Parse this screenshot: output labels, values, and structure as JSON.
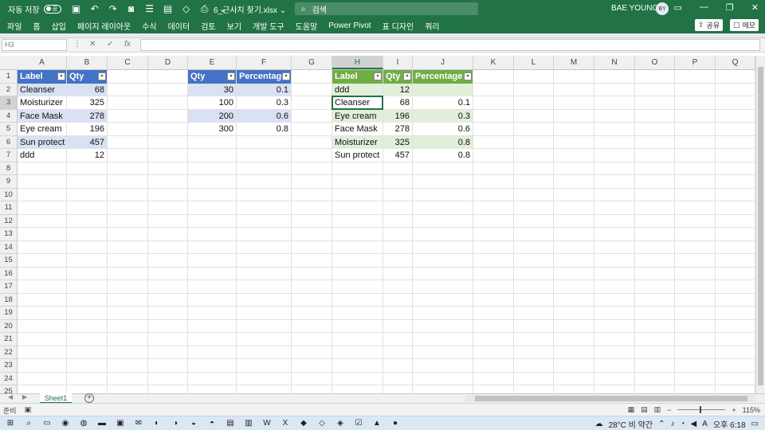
{
  "titlebar": {
    "autosave_label": "자동 저장",
    "autosave_state": "끔",
    "filename": "6_근사치 찾기.xlsx",
    "filename_caret": "⌄",
    "search_placeholder": "검색",
    "user_name": "BAE YOUNGJA",
    "user_initials": "BY"
  },
  "ribbon": {
    "tabs": [
      "파일",
      "홈",
      "삽입",
      "페이지 레이아웃",
      "수식",
      "데이터",
      "검토",
      "보기",
      "개발 도구",
      "도움말",
      "Power Pivot",
      "표 디자인",
      "쿼리"
    ],
    "share_label": "공유",
    "comment_label": "메모"
  },
  "formula_bar": {
    "name_box": "H3",
    "fx_label": "fx",
    "formula": ""
  },
  "columns": [
    "A",
    "B",
    "C",
    "D",
    "E",
    "F",
    "G",
    "H",
    "I",
    "J",
    "K",
    "L",
    "M",
    "N",
    "O",
    "P",
    "Q"
  ],
  "rows": [
    "1",
    "2",
    "3",
    "4",
    "5",
    "6",
    "7",
    "8",
    "9",
    "10",
    "11",
    "12",
    "13",
    "14",
    "15",
    "16",
    "17",
    "18",
    "19",
    "20",
    "21",
    "22",
    "23",
    "24",
    "25"
  ],
  "table1": {
    "headers": [
      "Label",
      "Qty"
    ],
    "rows": [
      [
        "Cleanser",
        "68"
      ],
      [
        "Moisturizer",
        "325"
      ],
      [
        "Face Mask",
        "278"
      ],
      [
        "Eye cream",
        "196"
      ],
      [
        "Sun protect",
        "457"
      ],
      [
        "ddd",
        "12"
      ]
    ]
  },
  "table2": {
    "headers": [
      "Qty",
      "Percentage"
    ],
    "rows": [
      [
        "30",
        "0.1"
      ],
      [
        "100",
        "0.3"
      ],
      [
        "200",
        "0.6"
      ],
      [
        "300",
        "0.8"
      ]
    ]
  },
  "table3": {
    "headers": [
      "Label",
      "Qty",
      "Percentage"
    ],
    "rows": [
      [
        "ddd",
        "12",
        ""
      ],
      [
        "Cleanser",
        "68",
        "0.1"
      ],
      [
        "Eye cream",
        "196",
        "0.3"
      ],
      [
        "Face Mask",
        "278",
        "0.6"
      ],
      [
        "Moisturizer",
        "325",
        "0.8"
      ],
      [
        "Sun protect",
        "457",
        "0.8"
      ]
    ]
  },
  "sheets": [
    "Sheet1"
  ],
  "statusbar": {
    "ready": "준비",
    "zoom": "115%"
  },
  "taskbar": {
    "weather": "28°C 비 약간",
    "lang": "A",
    "time": "오후 6:18"
  },
  "colors": {
    "excel_green": "#217346",
    "table_blue": "#4472c4",
    "band_blue": "#d9e1f2",
    "table_green": "#70ad47",
    "band_green": "#e2efda"
  }
}
